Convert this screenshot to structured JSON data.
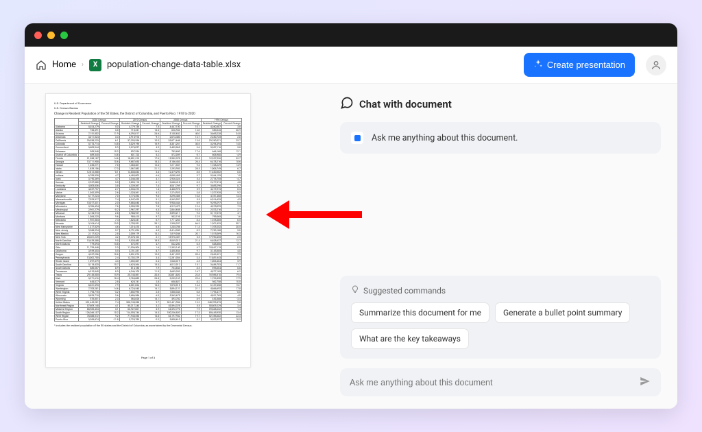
{
  "breadcrumb": {
    "home": "Home",
    "filename": "population-change-data-table.xlsx"
  },
  "toolbar": {
    "create_btn": "Create presentation"
  },
  "chat": {
    "header": "Chat with document",
    "intro": "Ask me anything about this document.",
    "suggest_title": "Suggested commands",
    "suggestions": [
      "Summarize this document for me",
      "Generate a bullet point summary",
      "What are the key takeaways"
    ],
    "input_placeholder": "Ask me anything about this document"
  },
  "doc": {
    "dept": "U.S. Department of Commerce",
    "bureau": "U.S. Census Bureau",
    "title": "Change in Resident Population of the 50 States, the District of Columbia, and Puerto Rico: 1910 to 2020",
    "group_headers": [
      "2020 Census",
      "2010 Census",
      "2000 Census",
      "1990 Census"
    ],
    "col_headers": [
      "Area",
      "Resident Change",
      "Percent Change",
      "Resident Change",
      "Percent Change",
      "Resident Change",
      "Percent Change",
      "Resident Change",
      "Percent Change"
    ],
    "rows": [
      [
        "Alabama",
        "5,024,279",
        "5.0",
        "4,779,736",
        "7.5",
        "4,447,100",
        "10.1",
        "4,040,587",
        "3.8"
      ],
      [
        "Alaska",
        "733,391",
        "3.0",
        "710,231",
        "13.3",
        "626,932",
        "14.0",
        "550,043",
        "36.9"
      ],
      [
        "Arizona",
        "7,151,502",
        "11.9",
        "6,392,017",
        "24.6",
        "5,130,632",
        "40.0",
        "3,665,228",
        "34.8"
      ],
      [
        "Arkansas",
        "3,011,524",
        "3.3",
        "2,915,918",
        "9.1",
        "2,673,400",
        "13.7",
        "2,350,725",
        "2.8"
      ],
      [
        "California",
        "39,538,223",
        "6.1",
        "37,253,956",
        "10.0",
        "33,871,648",
        "13.8",
        "29,760,021",
        "25.7"
      ],
      [
        "Colorado",
        "5,773,714",
        "14.8",
        "5,029,196",
        "16.9",
        "4,301,261",
        "30.6",
        "3,294,394",
        "14.0"
      ],
      [
        "Connecticut",
        "3,605,944",
        "0.9",
        "3,574,097",
        "4.9",
        "3,405,565",
        "3.6",
        "3,287,116",
        "5.8"
      ],
      [
        "Delaware",
        "989,948",
        "10.2",
        "897,934",
        "14.6",
        "783,600",
        "17.6",
        "666,168",
        "12.1"
      ],
      [
        "District of Columbia",
        "689,545",
        "14.6",
        "601,723",
        "5.2",
        "572,059",
        "-5.7",
        "606,900",
        "-4.9"
      ],
      [
        "Florida",
        "21,538,187",
        "14.6",
        "18,801,310",
        "17.6",
        "15,982,378",
        "23.5",
        "12,937,926",
        "32.7"
      ],
      [
        "Georgia",
        "10,711,908",
        "10.6",
        "9,687,653",
        "18.3",
        "8,186,453",
        "26.4",
        "6,478,216",
        "18.6"
      ],
      [
        "Hawaii",
        "1,455,271",
        "7.0",
        "1,360,301",
        "12.3",
        "1,211,537",
        "9.3",
        "1,108,229",
        "14.9"
      ],
      [
        "Idaho",
        "1,839,106",
        "17.3",
        "1,567,582",
        "21.1",
        "1,293,953",
        "28.5",
        "1,006,749",
        "6.7"
      ],
      [
        "Illinois",
        "12,812,508",
        "-0.1",
        "12,830,632",
        "3.3",
        "12,419,293",
        "8.6",
        "11,430,602",
        "0.0"
      ],
      [
        "Indiana",
        "6,785,528",
        "4.7",
        "6,483,802",
        "6.6",
        "6,080,485",
        "9.7",
        "5,544,159",
        "1.0"
      ],
      [
        "Iowa",
        "3,190,369",
        "4.7",
        "3,046,355",
        "4.1",
        "2,926,324",
        "5.4",
        "2,776,755",
        "-4.7"
      ],
      [
        "Kansas",
        "2,937,880",
        "3.0",
        "2,853,118",
        "6.1",
        "2,688,418",
        "8.5",
        "2,477,574",
        "4.8"
      ],
      [
        "Kentucky",
        "4,505,836",
        "3.8",
        "4,339,367",
        "7.4",
        "4,041,769",
        "9.7",
        "3,685,296",
        "0.7"
      ],
      [
        "Louisiana",
        "4,657,757",
        "2.7",
        "4,533,372",
        "1.4",
        "4,468,976",
        "5.9",
        "4,219,973",
        "0.3"
      ],
      [
        "Maine",
        "1,362,359",
        "2.6",
        "1,328,361",
        "4.2",
        "1,274,923",
        "3.8",
        "1,227,928",
        "9.2"
      ],
      [
        "Maryland",
        "6,177,224",
        "7.0",
        "5,773,552",
        "9.0",
        "5,296,486",
        "10.8",
        "4,781,468",
        "13.4"
      ],
      [
        "Massachusetts",
        "7,029,917",
        "7.4",
        "6,547,629",
        "3.1",
        "6,349,097",
        "5.5",
        "6,016,425",
        "4.9"
      ],
      [
        "Michigan",
        "10,077,331",
        "2.0",
        "9,883,640",
        "-0.6",
        "9,938,444",
        "6.9",
        "9,295,297",
        "0.4"
      ],
      [
        "Minnesota",
        "5,706,494",
        "7.6",
        "5,303,925",
        "7.8",
        "4,919,479",
        "12.4",
        "4,375,099",
        "7.3"
      ],
      [
        "Mississippi",
        "2,961,279",
        "-0.2",
        "2,967,297",
        "4.3",
        "2,844,658",
        "10.5",
        "2,573,216",
        "2.1"
      ],
      [
        "Missouri",
        "6,154,913",
        "2.8",
        "5,988,927",
        "7.0",
        "5,595,211",
        "9.3",
        "5,117,073",
        "4.1"
      ],
      [
        "Montana",
        "1,084,225",
        "9.6",
        "989,415",
        "9.7",
        "902,195",
        "12.9",
        "799,065",
        "1.6"
      ],
      [
        "Nebraska",
        "1,961,504",
        "7.4",
        "1,826,341",
        "6.7",
        "1,711,263",
        "8.4",
        "1,578,385",
        "0.5"
      ],
      [
        "Nevada",
        "3,104,614",
        "15.0",
        "2,700,551",
        "35.1",
        "1,998,257",
        "66.3",
        "1,201,833",
        "50.1"
      ],
      [
        "New Hampshire",
        "1,377,529",
        "4.6",
        "1,316,470",
        "6.5",
        "1,235,786",
        "11.4",
        "1,109,252",
        "20.5"
      ],
      [
        "New Jersey",
        "9,288,994",
        "5.7",
        "8,791,894",
        "4.5",
        "8,414,350",
        "8.9",
        "7,730,188",
        "5.0"
      ],
      [
        "New Mexico",
        "2,117,522",
        "2.8",
        "2,059,179",
        "13.2",
        "1,819,046",
        "20.1",
        "1,515,069",
        "16.3"
      ],
      [
        "New York",
        "20,201,249",
        "4.2",
        "19,378,102",
        "2.1",
        "18,976,457",
        "5.5",
        "17,990,455",
        "2.5"
      ],
      [
        "North Carolina",
        "10,439,388",
        "9.5",
        "9,535,483",
        "18.5",
        "8,049,313",
        "21.4",
        "6,628,637",
        "12.7"
      ],
      [
        "North Dakota",
        "779,094",
        "15.8",
        "672,591",
        "4.7",
        "642,200",
        "0.5",
        "638,800",
        "-2.1"
      ],
      [
        "Ohio",
        "11,799,448",
        "2.3",
        "11,536,504",
        "1.6",
        "11,353,140",
        "4.7",
        "10,847,115",
        "0.5"
      ],
      [
        "Oklahoma",
        "3,959,353",
        "5.5",
        "3,751,351",
        "8.7",
        "3,450,654",
        "9.7",
        "3,145,585",
        "4.0"
      ],
      [
        "Oregon",
        "4,237,256",
        "10.6",
        "3,831,074",
        "12.0",
        "3,421,399",
        "20.4",
        "2,842,321",
        "7.9"
      ],
      [
        "Pennsylvania",
        "13,002,700",
        "2.4",
        "12,702,379",
        "3.4",
        "12,281,054",
        "3.4",
        "11,881,643",
        "0.1"
      ],
      [
        "Rhode Island",
        "1,097,379",
        "4.3",
        "1,052,567",
        "0.4",
        "1,048,319",
        "4.5",
        "1,003,464",
        "5.9"
      ],
      [
        "South Carolina",
        "5,118,425",
        "10.7",
        "4,625,364",
        "15.3",
        "4,012,012",
        "15.1",
        "3,486,703",
        "11.7"
      ],
      [
        "South Dakota",
        "886,667",
        "8.9",
        "814,180",
        "7.9",
        "754,844",
        "8.5",
        "696,004",
        "0.8"
      ],
      [
        "Tennessee",
        "6,910,840",
        "8.9",
        "6,346,105",
        "11.5",
        "5,689,283",
        "16.7",
        "4,877,185",
        "6.2"
      ],
      [
        "Texas",
        "29,145,505",
        "15.9",
        "25,145,561",
        "20.6",
        "20,851,820",
        "22.8",
        "16,986,510",
        "19.4"
      ],
      [
        "Utah",
        "3,271,616",
        "18.4",
        "2,763,885",
        "23.8",
        "2,233,169",
        "29.6",
        "1,722,850",
        "17.9"
      ],
      [
        "Vermont",
        "643,077",
        "2.8",
        "625,741",
        "2.8",
        "608,827",
        "8.2",
        "562,758",
        "10.0"
      ],
      [
        "Virginia",
        "8,631,393",
        "7.9",
        "8,001,024",
        "13.0",
        "7,078,515",
        "14.4",
        "6,187,358",
        "15.7"
      ],
      [
        "Washington",
        "7,705,281",
        "14.6",
        "6,724,540",
        "14.1",
        "5,894,121",
        "21.1",
        "4,866,692",
        "17.8"
      ],
      [
        "West Virginia",
        "1,793,716",
        "-3.2",
        "1,852,994",
        "2.5",
        "1,808,344",
        "0.8",
        "1,793,477",
        "-8.0"
      ],
      [
        "Wisconsin",
        "5,893,718",
        "3.6",
        "5,686,986",
        "6.0",
        "5,363,675",
        "9.6",
        "4,891,769",
        "4.0"
      ],
      [
        "Wyoming",
        "576,851",
        "2.3",
        "563,626",
        "14.1",
        "493,782",
        "8.9",
        "453,588",
        "-3.4"
      ],
      [
        "United States",
        "331,449,281",
        "7.4",
        "308,745,538",
        "9.7",
        "281,421,906",
        "13.2",
        "248,709,873",
        "9.8"
      ],
      [
        "Northeast Region",
        "57,609,148",
        "4.1",
        "55,317,240",
        "3.2",
        "53,594,378",
        "5.5",
        "50,809,229",
        "3.4"
      ],
      [
        "Midwest Region",
        "68,985,454",
        "3.1",
        "66,927,001",
        "3.9",
        "64,392,776",
        "7.9",
        "59,668,632",
        "1.4"
      ],
      [
        "South Region",
        "126,266,107",
        "10.2",
        "114,555,744",
        "14.3",
        "100,236,820",
        "17.3",
        "85,445,930",
        "13.4"
      ],
      [
        "West Region",
        "78,588,572",
        "9.2",
        "71,945,553",
        "13.8",
        "63,197,932",
        "19.7",
        "52,786,082",
        "22.3"
      ],
      [
        "Puerto Rico",
        "3,285,874",
        "-11.8",
        "3,725,789",
        "-2.2",
        "3,808,610",
        "8.1",
        "3,522,037",
        "10.2"
      ]
    ],
    "footnote": "¹ Includes the resident population of the 50 states and the District of Columbia, as ascertained by the Decennial Census.",
    "page": "Page 1 of 3"
  }
}
